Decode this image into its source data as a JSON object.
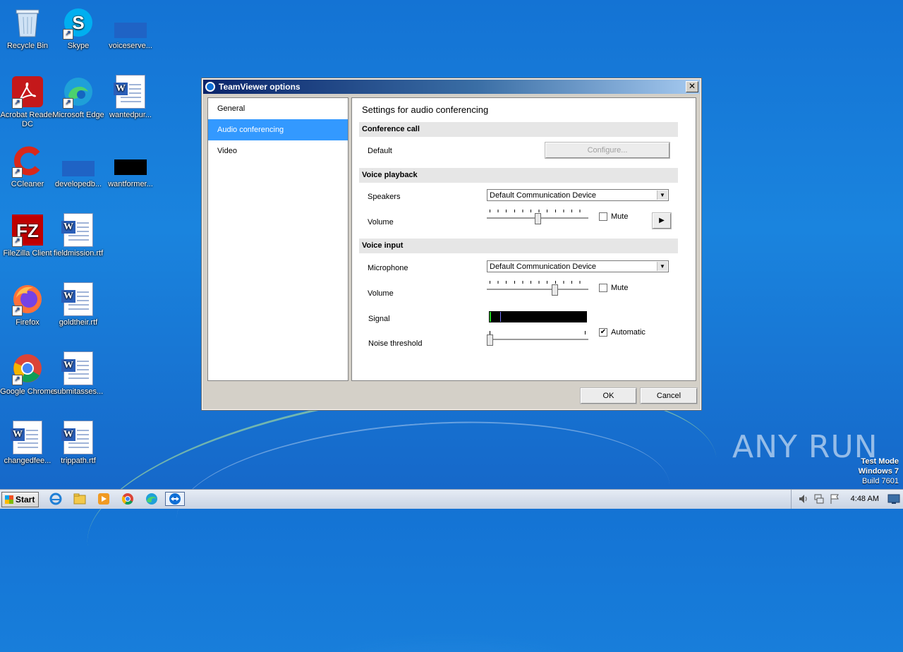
{
  "desktop": {
    "icons": [
      {
        "label": "Recycle Bin"
      },
      {
        "label": "Skype"
      },
      {
        "label": "voiceserve..."
      },
      {
        "label": "Acrobat Reader DC"
      },
      {
        "label": "Microsoft Edge"
      },
      {
        "label": "wantedpur..."
      },
      {
        "label": "CCleaner"
      },
      {
        "label": "developedb..."
      },
      {
        "label": "wantformer..."
      },
      {
        "label": "FileZilla Client"
      },
      {
        "label": "fieldmission.rtf"
      },
      {
        "label": "Firefox"
      },
      {
        "label": "goldtheir.rtf"
      },
      {
        "label": "Google Chrome"
      },
      {
        "label": "submitasses..."
      },
      {
        "label": "changedfee..."
      },
      {
        "label": "trippath.rtf"
      }
    ]
  },
  "window": {
    "title": "TeamViewer options",
    "close_glyph": "✕",
    "nav": [
      {
        "label": "General"
      },
      {
        "label": "Audio conferencing",
        "selected": true
      },
      {
        "label": "Video"
      }
    ],
    "pane_title": "Settings for audio conferencing",
    "conference": {
      "header": "Conference call",
      "default_label": "Default",
      "configure_label": "Configure..."
    },
    "playback": {
      "header": "Voice playback",
      "speakers_label": "Speakers",
      "speakers_value": "Default Communication Device",
      "volume_label": "Volume",
      "volume_level": 0.5,
      "mute_label": "Mute",
      "mute_checked": false,
      "play_glyph": "▶"
    },
    "input": {
      "header": "Voice input",
      "mic_label": "Microphone",
      "mic_value": "Default Communication Device",
      "volume_label": "Volume",
      "volume_level": 0.68,
      "mute_label": "Mute",
      "mute_checked": false,
      "signal_label": "Signal",
      "noise_label": "Noise threshold",
      "noise_level": 0.0,
      "automatic_label": "Automatic",
      "automatic_checked": true
    },
    "ok_label": "OK",
    "cancel_label": "Cancel"
  },
  "taskbar": {
    "start_label": "Start",
    "clock": "4:48 AM"
  },
  "watermark": {
    "line1": "Test Mode",
    "line2": "Windows 7",
    "line3": "Build 7601",
    "brand": "ANY RUN"
  },
  "colors": {
    "selection": "#3399ff",
    "titlebar": "#0a246a",
    "desktop": "#1a84de"
  }
}
